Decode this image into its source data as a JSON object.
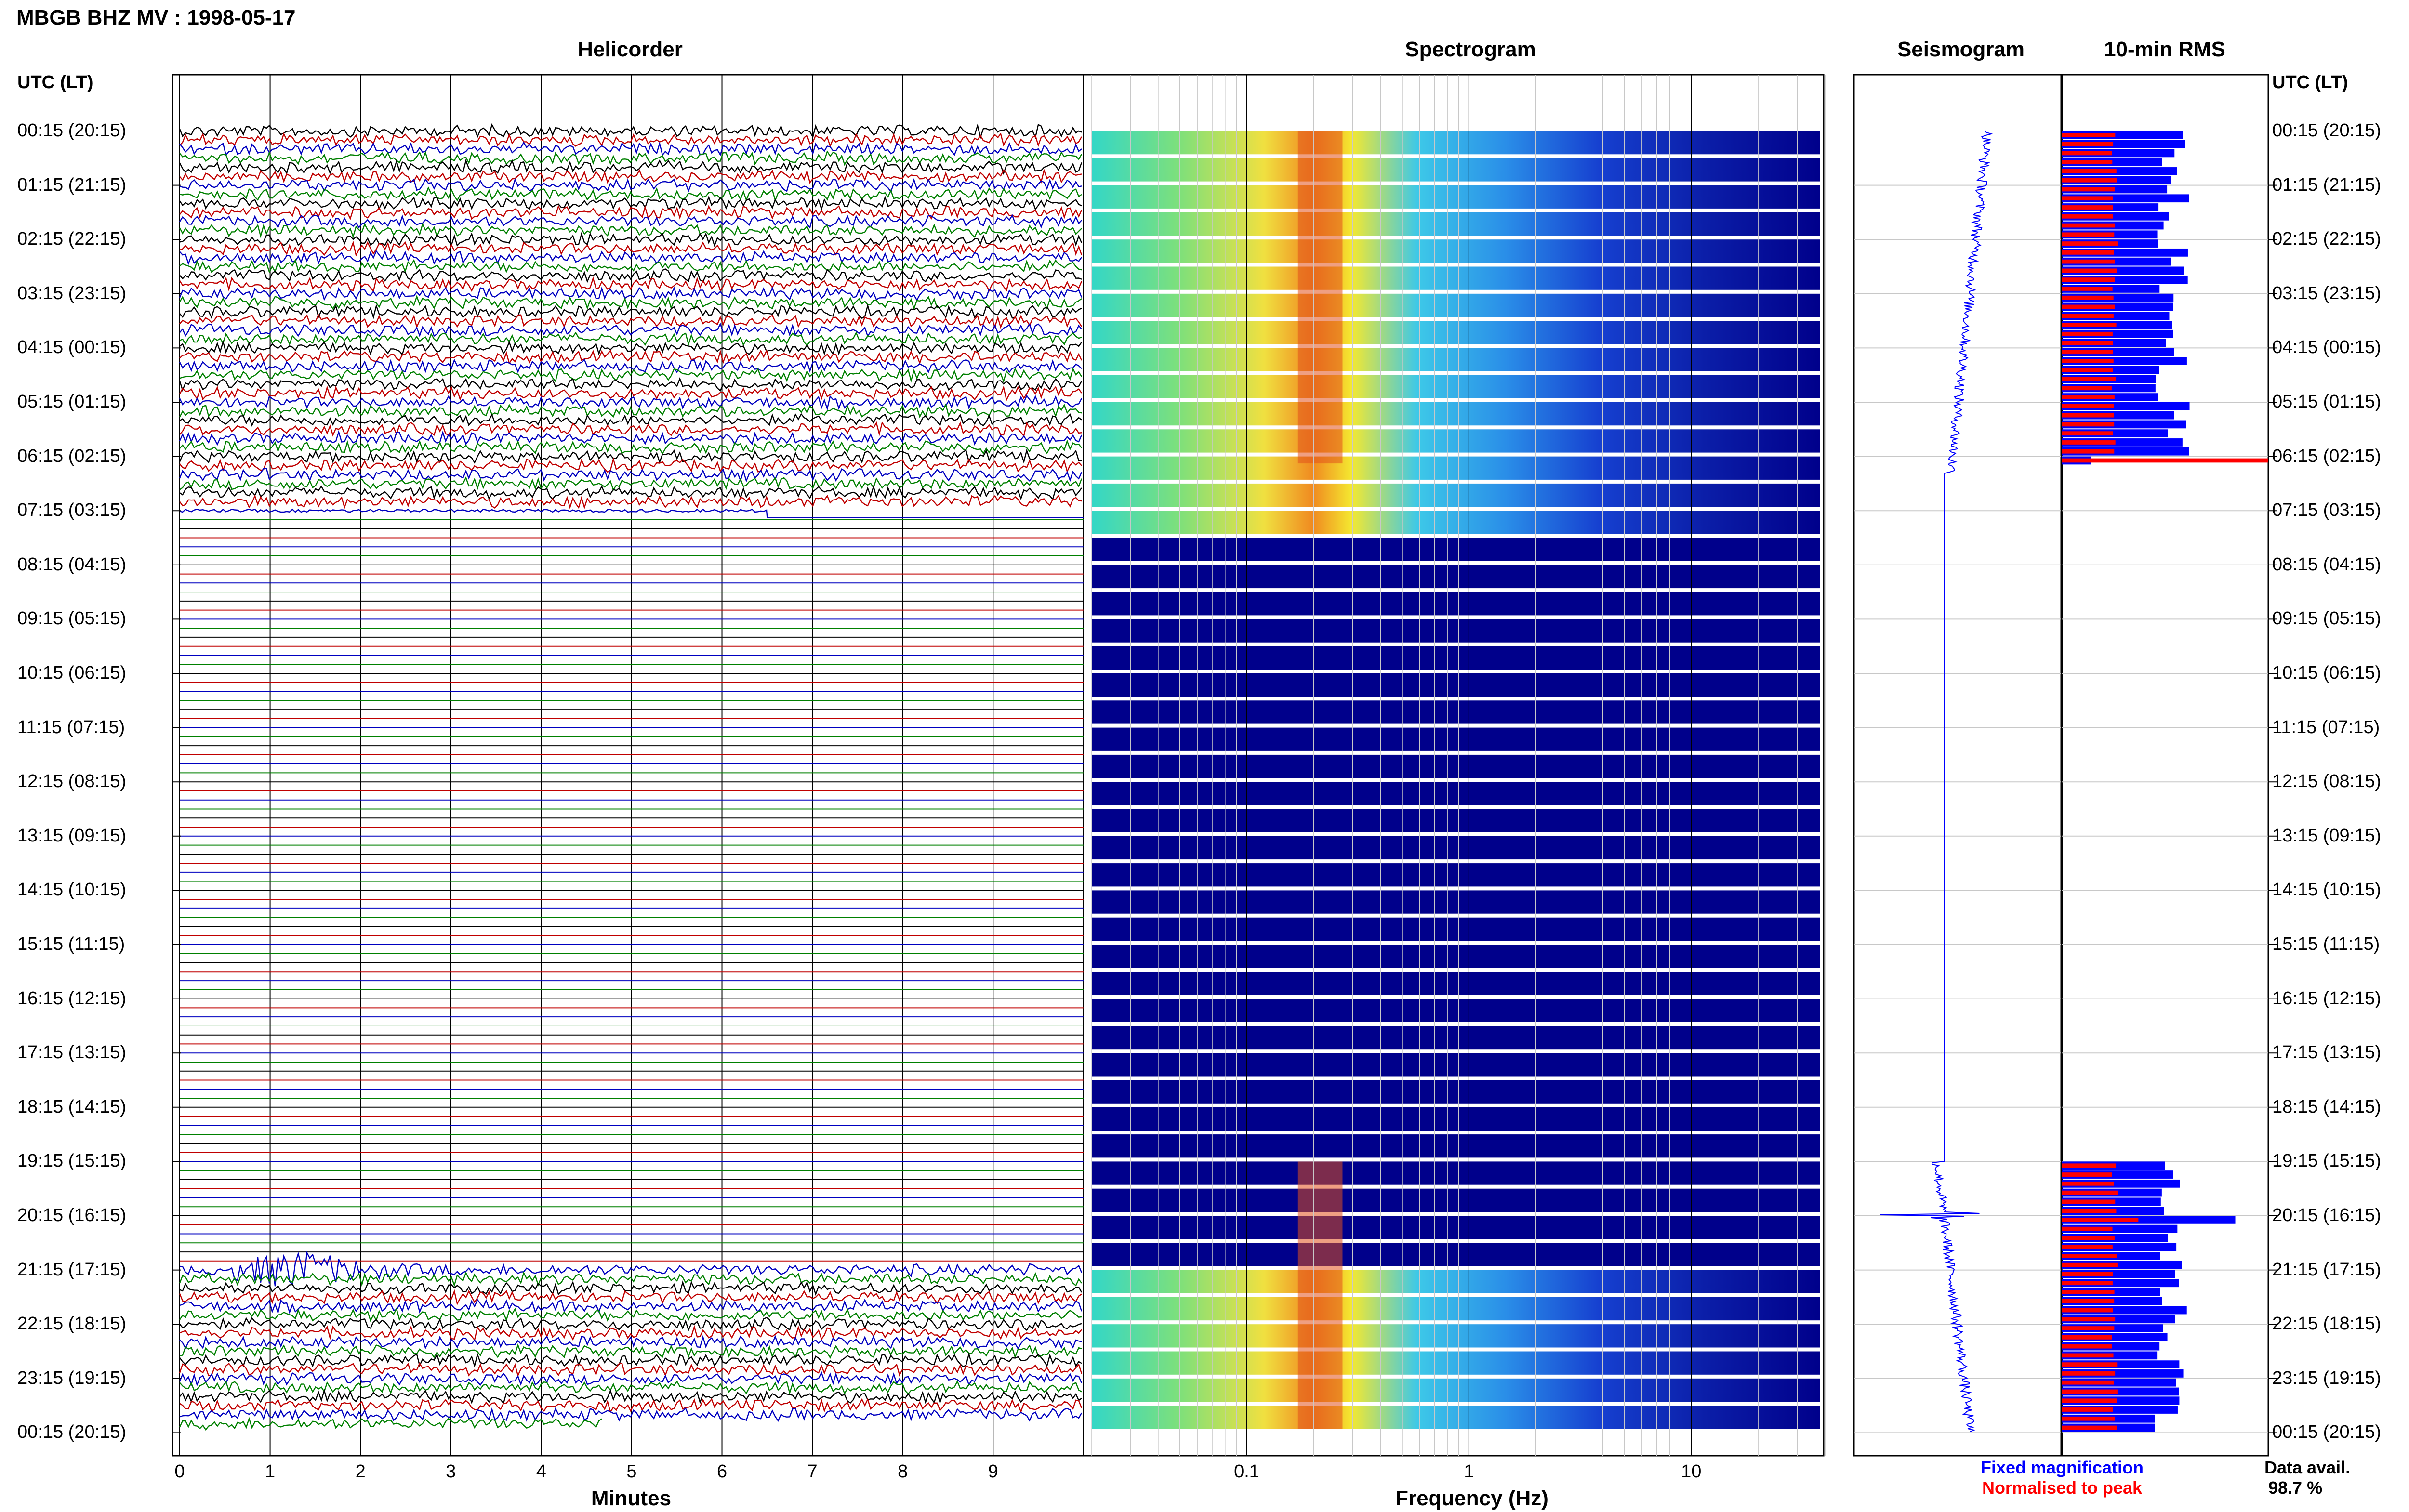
{
  "header": {
    "title": "MBGB BHZ MV : 1998-05-17",
    "utc_label_left": "UTC (LT)",
    "utc_label_right": "UTC (LT)"
  },
  "panels": {
    "helicorder": "Helicorder",
    "spectrogram": "Spectrogram",
    "seismogram": "Seismogram",
    "rms": "10-min RMS"
  },
  "time_labels": [
    "00:15 (20:15)",
    "01:15 (21:15)",
    "02:15 (22:15)",
    "03:15 (23:15)",
    "04:15 (00:15)",
    "05:15 (01:15)",
    "06:15 (02:15)",
    "07:15 (03:15)",
    "08:15 (04:15)",
    "09:15 (05:15)",
    "10:15 (06:15)",
    "11:15 (07:15)",
    "12:15 (08:15)",
    "13:15 (09:15)",
    "14:15 (10:15)",
    "15:15 (11:15)",
    "16:15 (12:15)",
    "17:15 (13:15)",
    "18:15 (14:15)",
    "19:15 (15:15)",
    "20:15 (16:15)",
    "21:15 (17:15)",
    "22:15 (18:15)",
    "23:15 (19:15)",
    "00:15 (20:15)"
  ],
  "minutes_axis": {
    "label": "Minutes",
    "ticks": [
      "0",
      "1",
      "2",
      "3",
      "4",
      "5",
      "6",
      "7",
      "8",
      "9"
    ]
  },
  "frequency_axis": {
    "label": "Frequency (Hz)",
    "ticks": [
      "0.1",
      "1",
      "10"
    ]
  },
  "legend": {
    "fixed": "Fixed magnification",
    "normalised": "Normalised to peak"
  },
  "availability": {
    "label": "Data avail.",
    "value": "98.7 %"
  },
  "colors": {
    "trace_cycle": [
      "#000000",
      "#c00000",
      "#0000c0",
      "#008000"
    ],
    "fixed_magnification": "#0000ff",
    "normalised_to_peak": "#ff0000",
    "spectrogram_floor": "#00008b",
    "grid": "#c8c8c8"
  },
  "chart_data": [
    {
      "type": "line",
      "name": "helicorder",
      "xlabel": "Minutes",
      "xlim": [
        0,
        10
      ],
      "rows_per_hour": 6,
      "total_rows": 144,
      "row_activity": "rows 0-42 show continuous tremor; row 42 ends in a step and rows 43-138 are flat; row 126 contains an event at about 0.6-3.5 min; row 144 ends at about 4.7 min",
      "active_row_ranges": [
        [
          0,
          42
        ],
        [
          126,
          143
        ]
      ],
      "event": {
        "row": 126,
        "start_min": 0.6,
        "peak_min": 1.3,
        "end_min": 3.5
      }
    },
    {
      "type": "heatmap",
      "name": "spectrogram",
      "xlabel": "Frequency (Hz)",
      "x_scale": "log",
      "xlim": [
        0.02,
        40
      ],
      "band_peak_hz": [
        0.17,
        0.27
      ],
      "active_row_ranges": [
        [
          0,
          42
        ],
        [
          126,
          143
        ]
      ]
    },
    {
      "type": "line",
      "name": "seismogram",
      "active_hours": [
        [
          0,
          6
        ],
        [
          19,
          24
        ]
      ],
      "event_hour": 20
    },
    {
      "type": "bar",
      "name": "10-min RMS",
      "series": [
        {
          "name": "Fixed magnification",
          "values_relative_to_panel_width": "blue bars roughly 0.45-0.62 of panel width on active rows; maximum at 20:15 (about 0.84)"
        },
        {
          "name": "Normalised to peak",
          "values_relative_to_panel_width": "red bars about 0.25 of panel width on active rows; 06:15 row at 1.0; event row 20:15 at about 0.37"
        }
      ]
    }
  ]
}
